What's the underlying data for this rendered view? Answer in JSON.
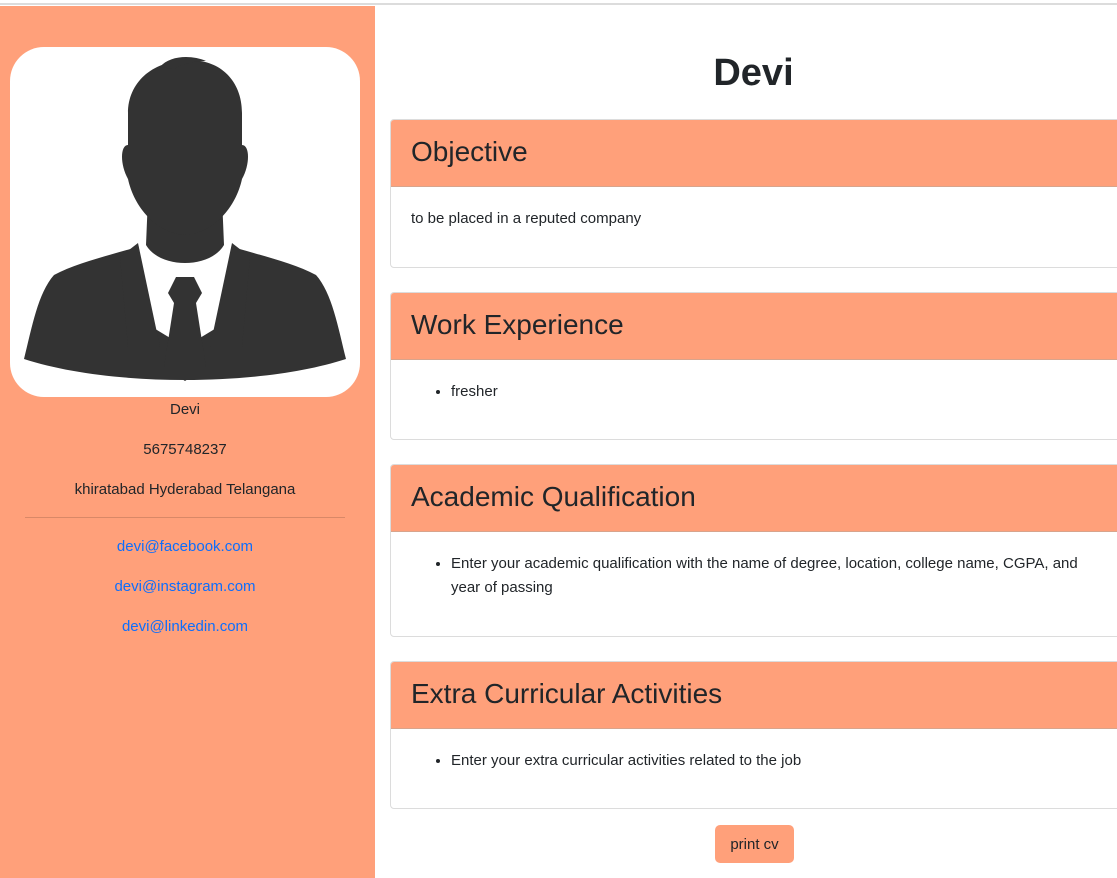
{
  "profile": {
    "name": "Devi",
    "phone": "5675748237",
    "address": "khiratabad Hyderabad Telangana",
    "photo_icon": "person-silhouette-icon"
  },
  "social": {
    "facebook": "devi@facebook.com",
    "instagram": "devi@instagram.com",
    "linkedin": "devi@linkedin.com"
  },
  "main": {
    "heading": "Devi",
    "sections": [
      {
        "title": "Objective",
        "text": "to be placed in a reputed company"
      },
      {
        "title": "Work Experience",
        "items": [
          "fresher"
        ]
      },
      {
        "title": "Academic Qualification",
        "items": [
          "Enter your academic qualification with the name of degree, location, college name, CGPA, and year of passing"
        ]
      },
      {
        "title": "Extra Curricular Activities",
        "items": [
          "Enter your extra curricular activities related to the job"
        ]
      }
    ],
    "print_label": "print cv"
  },
  "colors": {
    "accent": "#ffa07a",
    "link": "#0d6efd",
    "silhouette": "#333333"
  }
}
